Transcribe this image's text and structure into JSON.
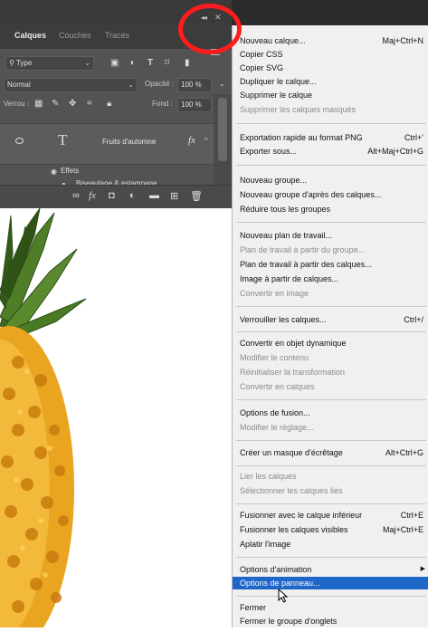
{
  "panel": {
    "tabs": [
      {
        "label": "Calques",
        "active": true
      },
      {
        "label": "Couches",
        "active": false
      },
      {
        "label": "Tracés",
        "active": false
      }
    ],
    "filter": {
      "value": "Type"
    },
    "blend_mode": {
      "value": "Normal"
    },
    "opacity": {
      "label": "Opacité :",
      "value": "100 %"
    },
    "lock": {
      "label": "Verrou :"
    },
    "fill": {
      "label": "Fond :",
      "value": "100 %"
    },
    "layer": {
      "thumbnail": "T",
      "name": "Fruits d'automne",
      "fx_badge": "fx"
    },
    "effects_label": "Effets",
    "effect_item": "Biseautage & estampage"
  },
  "menu": {
    "items": [
      {
        "label": "Nouveau calque...",
        "shortcut": "Maj+Ctrl+N",
        "disabled": false
      },
      {
        "label": "Copier CSS",
        "shortcut": "",
        "disabled": false
      },
      {
        "label": "Copier SVG",
        "shortcut": "",
        "disabled": false
      },
      {
        "label": "Dupliquer le calque...",
        "shortcut": "",
        "disabled": false
      },
      {
        "label": "Supprimer le calque",
        "shortcut": "",
        "disabled": false
      },
      {
        "label": "Supprimer les calques masqués",
        "shortcut": "",
        "disabled": true
      },
      {
        "label": "Exportation rapide au format PNG",
        "shortcut": "Ctrl+'",
        "disabled": false
      },
      {
        "label": "Exporter sous...",
        "shortcut": "Alt+Maj+Ctrl+G",
        "disabled": false
      },
      {
        "label": "Nouveau groupe...",
        "shortcut": "",
        "disabled": false
      },
      {
        "label": "Nouveau groupe d'après des calques...",
        "shortcut": "",
        "disabled": false
      },
      {
        "label": "Réduire tous les groupes",
        "shortcut": "",
        "disabled": false
      },
      {
        "label": "Nouveau plan de travail...",
        "shortcut": "",
        "disabled": false
      },
      {
        "label": "Plan de travail à partir du groupe...",
        "shortcut": "",
        "disabled": true
      },
      {
        "label": "Plan de travail à partir des calques...",
        "shortcut": "",
        "disabled": false
      },
      {
        "label": "Image à partir de calques...",
        "shortcut": "",
        "disabled": false
      },
      {
        "label": "Convertir en image",
        "shortcut": "",
        "disabled": true
      },
      {
        "label": "Verrouiller les calques...",
        "shortcut": "Ctrl+/",
        "disabled": false
      },
      {
        "label": "Convertir en objet dynamique",
        "shortcut": "",
        "disabled": false
      },
      {
        "label": "Modifier le contenu",
        "shortcut": "",
        "disabled": true
      },
      {
        "label": "Réinitialiser la transformation",
        "shortcut": "",
        "disabled": true
      },
      {
        "label": "Convertir en calques",
        "shortcut": "",
        "disabled": true
      },
      {
        "label": "Options de fusion...",
        "shortcut": "",
        "disabled": false
      },
      {
        "label": "Modifier le réglage...",
        "shortcut": "",
        "disabled": true
      },
      {
        "label": "Créer un masque d'écrêtage",
        "shortcut": "Alt+Ctrl+G",
        "disabled": false
      },
      {
        "label": "Lier les calques",
        "shortcut": "",
        "disabled": true
      },
      {
        "label": "Sélectionner les calques liés",
        "shortcut": "",
        "disabled": true
      },
      {
        "label": "Fusionner avec le calque inférieur",
        "shortcut": "Ctrl+E",
        "disabled": false
      },
      {
        "label": "Fusionner les calques visibles",
        "shortcut": "Maj+Ctrl+E",
        "disabled": false
      },
      {
        "label": "Aplatir l'image",
        "shortcut": "",
        "disabled": false
      },
      {
        "label": "Options d'animation",
        "shortcut": "",
        "disabled": false
      },
      {
        "label": "Options de panneau...",
        "shortcut": "",
        "disabled": false
      },
      {
        "label": "Fermer",
        "shortcut": "",
        "disabled": false
      },
      {
        "label": "Fermer le groupe d'onglets",
        "shortcut": "",
        "disabled": false
      }
    ]
  },
  "colors": {
    "highlight": "#1f66c9",
    "annotation_circle": "#ff1c1c",
    "panel_bg": "#535353"
  }
}
